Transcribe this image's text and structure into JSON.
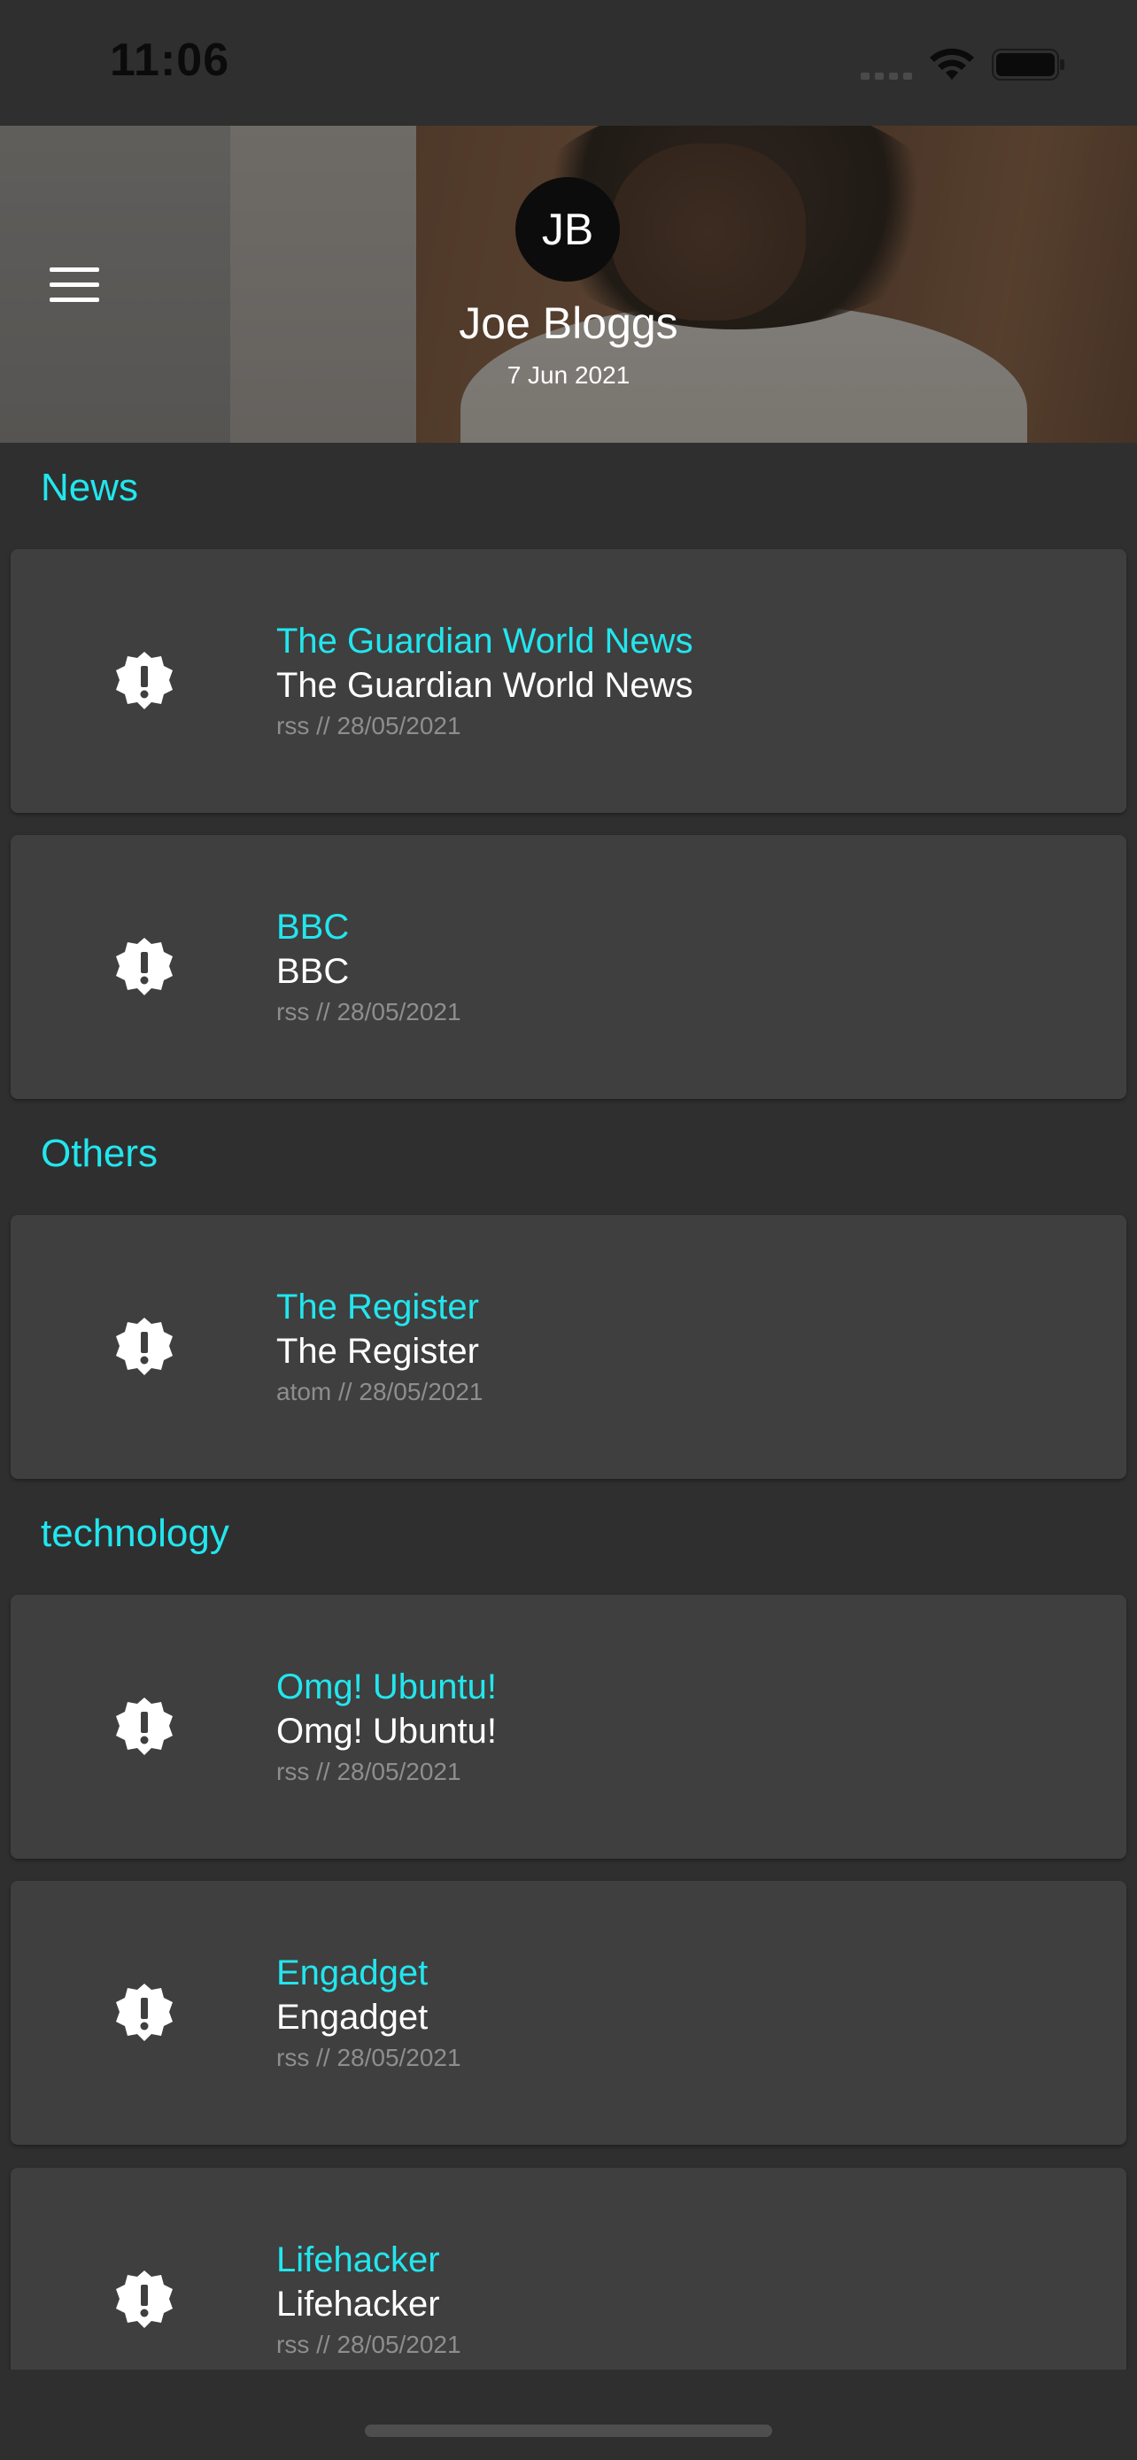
{
  "status_bar": {
    "time": "11:06"
  },
  "header": {
    "avatar_initials": "JB",
    "user_name": "Joe Bloggs",
    "date": "7 Jun 2021",
    "menu_icon": "hamburger-menu-icon"
  },
  "colors": {
    "accent": "#22e6ee",
    "background": "#2f2f2f",
    "card": "#3f3f3f",
    "meta_text": "#8e8e8e"
  },
  "sections": [
    {
      "title": "News",
      "feeds": [
        {
          "title": "The Guardian World News",
          "subtitle": "The Guardian World News",
          "meta": "rss // 28/05/2021",
          "icon": "alert-badge-icon"
        },
        {
          "title": "BBC",
          "subtitle": "BBC",
          "meta": "rss // 28/05/2021",
          "icon": "alert-badge-icon"
        }
      ]
    },
    {
      "title": "Others",
      "feeds": [
        {
          "title": "The Register",
          "subtitle": "The Register",
          "meta": "atom // 28/05/2021",
          "icon": "alert-badge-icon"
        }
      ]
    },
    {
      "title": "technology",
      "feeds": [
        {
          "title": "Omg! Ubuntu!",
          "subtitle": "Omg! Ubuntu!",
          "meta": "rss // 28/05/2021",
          "icon": "alert-badge-icon"
        },
        {
          "title": "Engadget",
          "subtitle": "Engadget",
          "meta": "rss // 28/05/2021",
          "icon": "alert-badge-icon"
        },
        {
          "title": "Lifehacker",
          "subtitle": "Lifehacker",
          "meta": "rss // 28/05/2021",
          "icon": "alert-badge-icon"
        }
      ]
    }
  ]
}
